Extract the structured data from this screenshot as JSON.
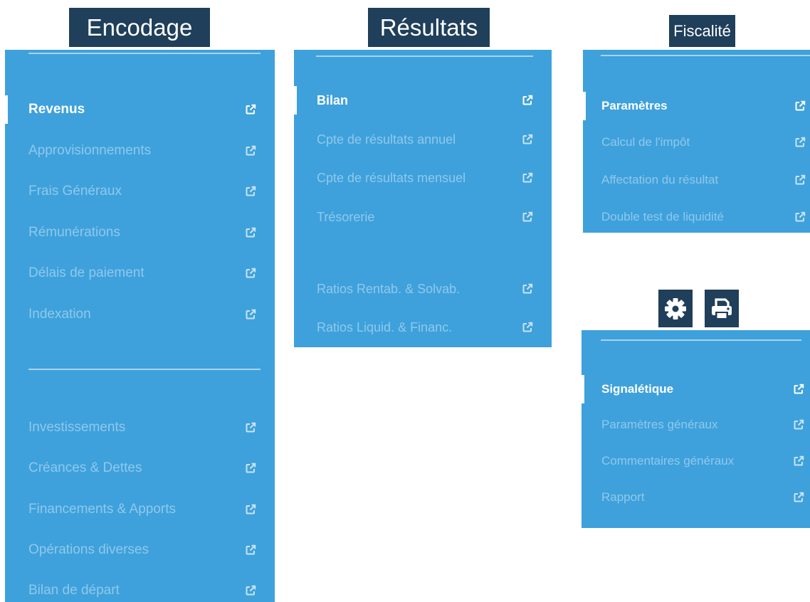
{
  "encodage": {
    "title": "Encodage",
    "items": [
      {
        "label": "Revenus",
        "active": true
      },
      {
        "label": "Approvisionnements"
      },
      {
        "label": "Frais Généraux"
      },
      {
        "label": "Rémunérations"
      },
      {
        "label": "Délais de paiement"
      },
      {
        "label": "Indexation"
      },
      {
        "label": "Investissements"
      },
      {
        "label": "Créances & Dettes"
      },
      {
        "label": "Financements & Apports"
      },
      {
        "label": "Opérations diverses"
      },
      {
        "label": "Bilan de départ"
      }
    ]
  },
  "resultats": {
    "title": "Résultats",
    "items": [
      {
        "label": "Bilan",
        "active": true
      },
      {
        "label": "Cpte de résultats annuel"
      },
      {
        "label": "Cpte de résultats mensuel"
      },
      {
        "label": "Trésorerie"
      },
      {
        "label": "Ratios Rentab. & Solvab."
      },
      {
        "label": "Ratios Liquid. & Financ."
      }
    ]
  },
  "fiscalite": {
    "title": "Fiscalité",
    "items": [
      {
        "label": "Paramètres",
        "active": true
      },
      {
        "label": "Calcul de l'impôt"
      },
      {
        "label": "Affectation du résultat"
      },
      {
        "label": "Double test de liquidité"
      }
    ]
  },
  "toolbar": {
    "settings_icon": "gear-icon",
    "print_icon": "printer-icon"
  },
  "signaletique": {
    "items": [
      {
        "label": "Signalétique",
        "active": true
      },
      {
        "label": "Paramètres généraux"
      },
      {
        "label": "Commentaires généraux"
      },
      {
        "label": "Rapport"
      }
    ]
  },
  "colors": {
    "panel": "#3ea1dc",
    "title_bg": "#1f3f5a",
    "active_text": "#ffffff"
  }
}
